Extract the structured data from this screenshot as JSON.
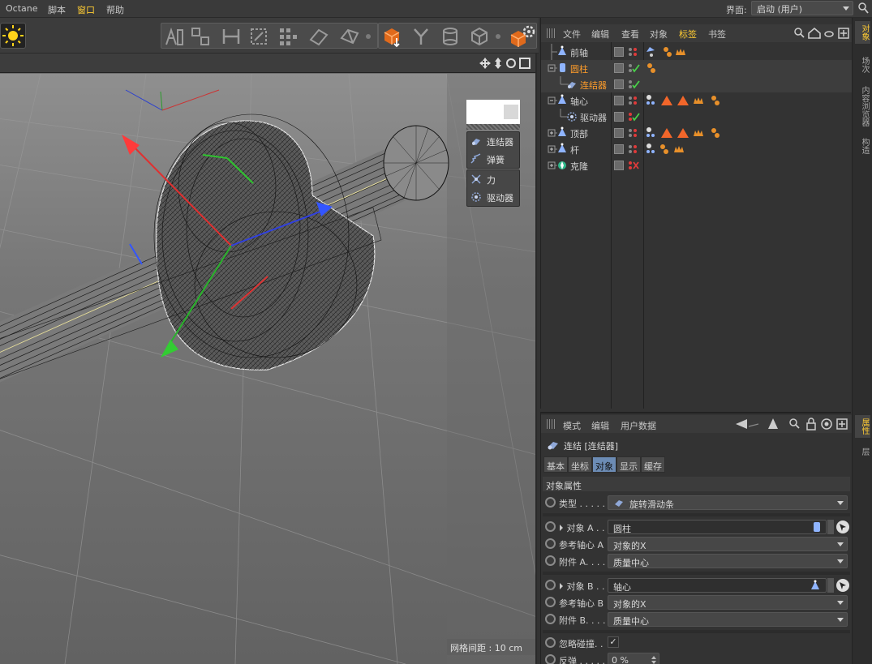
{
  "menubar": {
    "items": [
      {
        "label": "Octane"
      },
      {
        "label": "脚本"
      },
      {
        "label": "窗口"
      },
      {
        "label": "帮助"
      }
    ],
    "layout_label": "界面:",
    "layout_value": "启动 (用户)"
  },
  "viewport": {
    "grid_spacing": "网格间距 : 10 cm"
  },
  "popup": {
    "group1": [
      {
        "label": "连结器",
        "icon": "connector-icon"
      },
      {
        "label": "弹簧",
        "icon": "spring-icon"
      }
    ],
    "group2": [
      {
        "label": "力",
        "icon": "force-icon"
      },
      {
        "label": "驱动器",
        "icon": "motor-icon"
      }
    ]
  },
  "side_tabs": [
    "对象",
    "场次",
    "内容浏览器",
    "构造",
    "属性",
    "层"
  ],
  "object_manager": {
    "tabs": [
      "文件",
      "编辑",
      "查看",
      "对象",
      "标签",
      "书签"
    ],
    "active_tab": "标签",
    "objects": [
      {
        "name": "前轴",
        "highlight": false
      },
      {
        "name": "圆柱",
        "highlight": true
      },
      {
        "name": "连结器",
        "highlight": true
      },
      {
        "name": "轴心",
        "highlight": false
      },
      {
        "name": "驱动器",
        "highlight": false
      },
      {
        "name": "顶部",
        "highlight": false
      },
      {
        "name": "杆",
        "highlight": false
      },
      {
        "name": "克隆",
        "highlight": false
      }
    ]
  },
  "attribute_manager": {
    "tabs": [
      "模式",
      "编辑",
      "用户数据"
    ],
    "object_title": "连结 [连结器]",
    "subtabs": [
      "基本",
      "坐标",
      "对象",
      "显示",
      "缓存"
    ],
    "active_subtab": "对象",
    "section_title": "对象属性",
    "type_label": "类型 . . . . .",
    "type_value": "旋转滑动条",
    "object_a_label": "对象 A . .",
    "object_a_value": "圆柱",
    "ref_axis_a_label": "参考轴心 A",
    "ref_axis_a_value": "对象的X",
    "attach_a_label": "附件 A. . . .",
    "attach_a_value": "质量中心",
    "object_b_label": "对象 B . .",
    "object_b_value": "轴心",
    "ref_axis_b_label": "参考轴心 B",
    "ref_axis_b_value": "对象的X",
    "attach_b_label": "附件 B. . . .",
    "attach_b_value": "质量中心",
    "ignore_collision_label": "忽略碰撞. .",
    "ignore_collision_mark": "✓",
    "bounce_label": "反弹 . . . . .",
    "bounce_value": "0 %"
  },
  "colors": {
    "accent_orange": "#ff9d2a",
    "active_tab_yellow": "#ffcc33",
    "selected_subtab_blue": "#6c8cb5",
    "viewport_grey": "#6e6e6e",
    "panel_bg": "#333333"
  }
}
